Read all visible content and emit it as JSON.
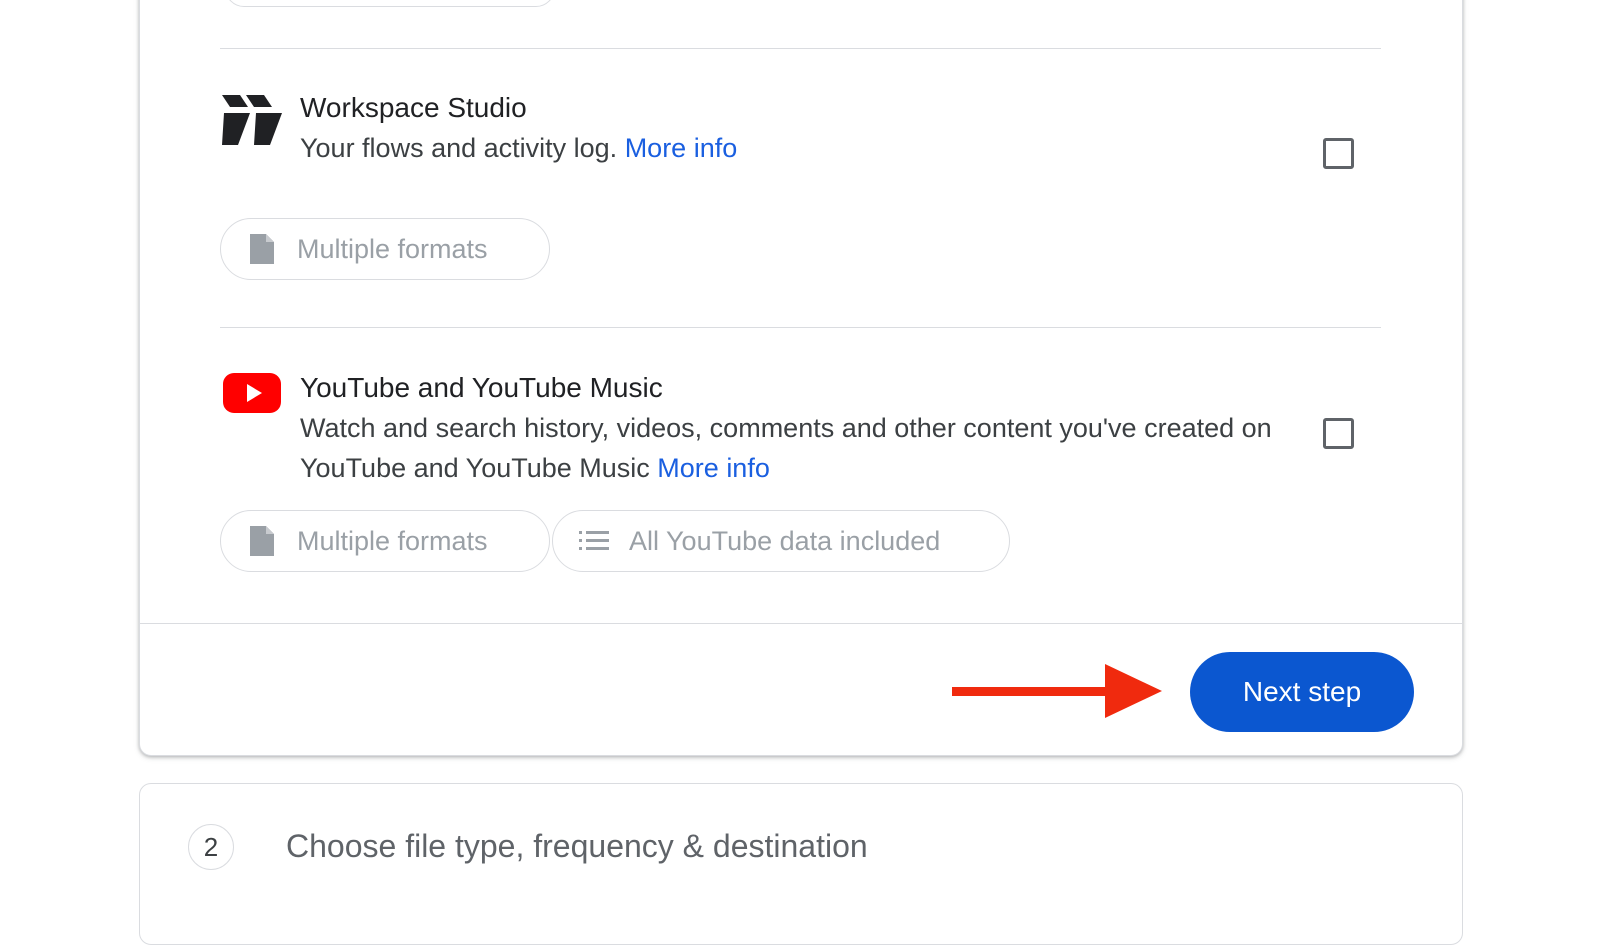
{
  "products": [
    {
      "title": "Workspace Studio",
      "description": "Your flows and activity log.",
      "more_info": "More info",
      "icon": "workspace-studio-logo",
      "checked": false,
      "chips": [
        {
          "icon": "file-icon",
          "label": "Multiple formats"
        }
      ]
    },
    {
      "title": "YouTube and YouTube Music",
      "description": "Watch and search history, videos, comments and other content you've created on YouTube and YouTube Music",
      "more_info": "More info",
      "icon": "youtube-logo",
      "checked": false,
      "chips": [
        {
          "icon": "file-icon",
          "label": "Multiple formats"
        },
        {
          "icon": "list-icon",
          "label": "All YouTube data included"
        }
      ]
    }
  ],
  "footer": {
    "next_button_label": "Next step",
    "annotation": "red-arrow-icon"
  },
  "next_section": {
    "step_number": "2",
    "title": "Choose file type, frequency & destination"
  },
  "colors": {
    "primary_button": "#0b57d0",
    "link": "#1a5fe0",
    "youtube_red": "#ff0000",
    "annotation_arrow": "#f02a0e"
  }
}
